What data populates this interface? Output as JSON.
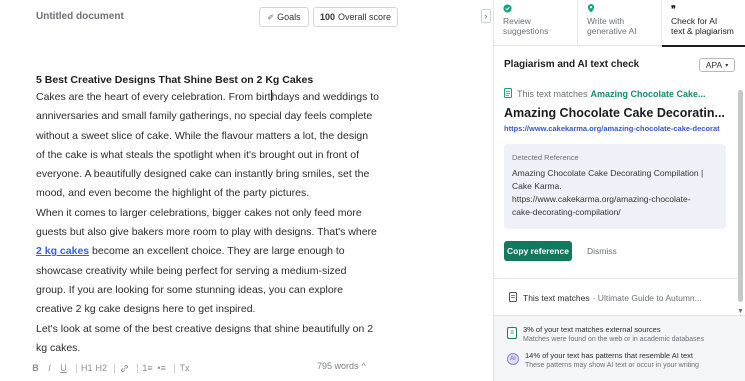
{
  "editor": {
    "doc_title": "Untitled document",
    "goals_label": "Goals",
    "score_value": "100",
    "score_label": "Overall score",
    "heading": "5 Best Creative Designs That Shine Best on 2 Kg Cakes",
    "line1_a": "Cakes are the heart of every celebration. From birt",
    "line1_b": "hdays and weddings to",
    "lines_a": [
      "anniversaries and small family gatherings, no special day feels complete",
      "without a sweet slice of cake. While the flavour matters a lot, the design",
      "of the cake is what steals the spotlight when it's brought out in front of",
      "everyone. A beautifully designed cake can instantly bring smiles, set the",
      "mood, and even become the highlight of the party pictures.",
      "When it comes to larger celebrations, bigger cakes not only feed more",
      "guests but also give bakers more room to play with designs. That's where"
    ],
    "link_text": "2 kg cakes",
    "link_rest": " become an excellent choice. They are large enough to",
    "lines_b": [
      "showcase creativity while being perfect for serving a medium-sized",
      "group. If you are looking for some stunning ideas, you can explore",
      "creative 2 kg cake designs here to get inspired.",
      "Let's look at some of the best creative designs that shine beautifully on 2",
      "kg cakes."
    ],
    "toolbar": [
      "B",
      "I",
      "U",
      "H1",
      "H2",
      "link",
      "1≡",
      "•≡",
      "Tx"
    ],
    "word_count": "795 words"
  },
  "panel": {
    "tabs": [
      {
        "label": "Review\nsuggestions",
        "icon": "check-circle-icon",
        "active": false
      },
      {
        "label": "Write with\ngenerative AI",
        "icon": "pin-icon",
        "active": false
      },
      {
        "label": "Check for AI\ntext & plagiarism",
        "icon": "quote-icon",
        "active": true
      }
    ],
    "title": "Plagiarism and AI text check",
    "citation_style": "APA",
    "match_prefix": "This text matches",
    "match_source": "Amazing Chocolate Cake...",
    "source_title": "Amazing Chocolate Cake Decoratin...",
    "source_url": "https://www.cakekarma.org/amazing-chocolate-cake-decorat",
    "ref_label": "Detected Reference",
    "ref_lines": [
      "Amazing Chocolate Cake Decorating Compilation |",
      "Cake Karma.",
      "https://www.cakekarma.org/amazing-chocolate-",
      "cake-decorating-compilation/"
    ],
    "copy_label": "Copy reference",
    "dismiss_label": "Dismiss",
    "second_match_prefix": "This text matches",
    "second_match_source": "· Ultimate Guide to Autumn...",
    "summary": [
      {
        "main": "3% of your text matches external sources",
        "sub": "Matches were found on the web or in academic databases",
        "icon": "document-icon"
      },
      {
        "main": "14% of your text has patterns that resemble AI text",
        "sub": "These patterns may show AI text or occur in your writing",
        "icon": "ai-icon"
      }
    ],
    "colors": {
      "accent": "#13785d",
      "link": "#3264d6",
      "match_green": "#168a6e"
    }
  }
}
